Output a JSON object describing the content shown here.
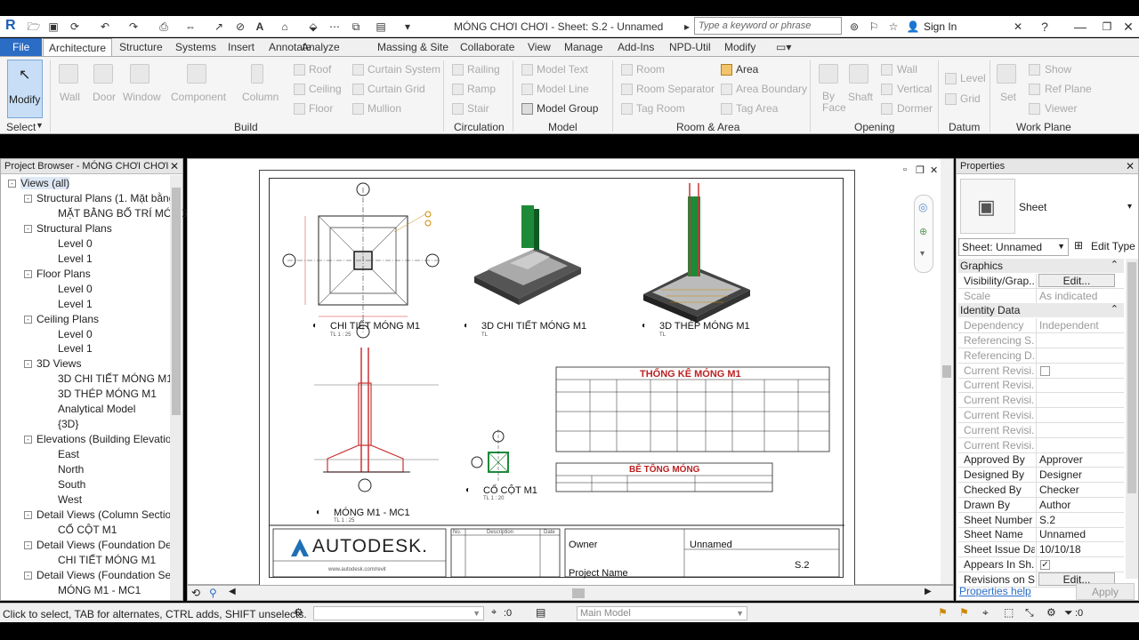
{
  "titlebar": {
    "app_letter": "R",
    "title": "MÓNG CHƠI CHƠI - Sheet: S.2 - Unnamed",
    "search_placeholder": "Type a keyword or phrase",
    "sign_in": "Sign In"
  },
  "ribbon_tabs": [
    "File",
    "Architecture",
    "Structure",
    "Systems",
    "Insert",
    "Annotate",
    "Analyze",
    "Massing & Site",
    "Collaborate",
    "View",
    "Manage",
    "Add-Ins",
    "NPD-Util",
    "Modify"
  ],
  "ribbon": {
    "modify": "Modify",
    "select": "Select",
    "build": {
      "wall": "Wall",
      "door": "Door",
      "window": "Window",
      "component": "Component",
      "column": "Column",
      "roof": "Roof",
      "ceiling": "Ceiling",
      "floor": "Floor",
      "curtain_system": "Curtain System",
      "curtain_grid": "Curtain Grid",
      "mullion": "Mullion",
      "label": "Build"
    },
    "circulation": {
      "railing": "Railing",
      "ramp": "Ramp",
      "stair": "Stair",
      "label": "Circulation"
    },
    "model": {
      "model_text": "Model Text",
      "model_line": "Model Line",
      "model_group": "Model Group",
      "label": "Model"
    },
    "room_area": {
      "room": "Room",
      "room_separator": "Room Separator",
      "tag_room": "Tag Room",
      "area": "Area",
      "area_boundary": "Area Boundary",
      "tag_area": "Tag Area",
      "label": "Room & Area"
    },
    "opening": {
      "by_face": "By Face",
      "shaft": "Shaft",
      "wall": "Wall",
      "vertical": "Vertical",
      "dormer": "Dormer",
      "label": "Opening"
    },
    "datum": {
      "level": "Level",
      "grid": "Grid",
      "label": "Datum"
    },
    "work_plane": {
      "set": "Set",
      "show": "Show",
      "ref_plane": "Ref Plane",
      "viewer": "Viewer",
      "label": "Work Plane"
    }
  },
  "project_browser": {
    "title": "Project Browser - MÓNG CHƠI CHƠI",
    "items": [
      {
        "label": "Views (all)",
        "level": 0,
        "toggle": "-"
      },
      {
        "label": "Structural Plans (1. Mặt bằng",
        "level": 1,
        "toggle": "-"
      },
      {
        "label": "MẶT BẰNG BỐ TRÍ MÓNG",
        "level": 2
      },
      {
        "label": "Structural Plans",
        "level": 1,
        "toggle": "-"
      },
      {
        "label": "Level 0",
        "level": 2
      },
      {
        "label": "Level 1",
        "level": 2
      },
      {
        "label": "Floor Plans",
        "level": 1,
        "toggle": "-"
      },
      {
        "label": "Level 0",
        "level": 2
      },
      {
        "label": "Level 1",
        "level": 2
      },
      {
        "label": "Ceiling Plans",
        "level": 1,
        "toggle": "-"
      },
      {
        "label": "Level 0",
        "level": 2
      },
      {
        "label": "Level 1",
        "level": 2
      },
      {
        "label": "3D Views",
        "level": 1,
        "toggle": "-"
      },
      {
        "label": "3D CHI TIẾT MÓNG M1",
        "level": 2
      },
      {
        "label": "3D THÉP MÓNG M1",
        "level": 2
      },
      {
        "label": "Analytical Model",
        "level": 2
      },
      {
        "label": "{3D}",
        "level": 2
      },
      {
        "label": "Elevations (Building Elevation",
        "level": 1,
        "toggle": "-"
      },
      {
        "label": "East",
        "level": 2
      },
      {
        "label": "North",
        "level": 2
      },
      {
        "label": "South",
        "level": 2
      },
      {
        "label": "West",
        "level": 2
      },
      {
        "label": "Detail Views (Column Section",
        "level": 1,
        "toggle": "-"
      },
      {
        "label": "CỔ CỘT M1",
        "level": 2
      },
      {
        "label": "Detail Views (Foundation Deta",
        "level": 1,
        "toggle": "-"
      },
      {
        "label": "CHI TIẾT MÓNG M1",
        "level": 2
      },
      {
        "label": "Detail Views (Foundation Sect",
        "level": 1,
        "toggle": "-"
      },
      {
        "label": "MÓNG M1 - MC1",
        "level": 2
      }
    ]
  },
  "sheet": {
    "views": [
      {
        "num": "S2",
        "sub": "5",
        "title": "CHI TIẾT MÓNG M1",
        "scale": "TL 1 : 25"
      },
      {
        "num": "S2",
        "sub": "4",
        "title": "3D CHI TIẾT MÓNG M1",
        "scale": "TL"
      },
      {
        "num": "S2",
        "sub": "3",
        "title": "3D THÉP MÓNG M1",
        "scale": "TL"
      },
      {
        "num": "S2",
        "sub": "2",
        "title": "MÓNG M1 - MC1",
        "scale": "TL 1 : 25"
      },
      {
        "num": "S2",
        "sub": "1",
        "title": "CỔ CỘT M1",
        "scale": "TL 1 : 20"
      }
    ],
    "schedule1_title": "THỐNG KÊ MÓNG M1",
    "schedule2_title": "BÊ TÔNG MÓNG",
    "titleblock": {
      "logo": "AUTODESK.",
      "url": "www.autodesk.com/revit",
      "rev_no": "No.",
      "rev_desc": "Description",
      "rev_date": "Date",
      "owner": "Owner",
      "project_name": "Project Name",
      "sheet_name": "Unnamed",
      "sheet_number": "S.2"
    }
  },
  "properties": {
    "title": "Properties",
    "type": "Sheet",
    "selector": "Sheet: Unnamed",
    "edit_type": "Edit Type",
    "sections": [
      {
        "name": "Graphics",
        "rows": [
          {
            "k": "Visibility/Grap...",
            "v": "Edit...",
            "btn": true
          },
          {
            "k": "Scale",
            "v": "As indicated",
            "dim": true
          }
        ]
      },
      {
        "name": "Identity Data",
        "rows": [
          {
            "k": "Dependency",
            "v": "Independent",
            "dim": true
          },
          {
            "k": "Referencing S...",
            "v": "",
            "dim": true
          },
          {
            "k": "Referencing D...",
            "v": "",
            "dim": true
          },
          {
            "k": "Current Revisi...",
            "v": "",
            "dim": true,
            "check": true
          },
          {
            "k": "Current Revisi...",
            "v": "",
            "dim": true
          },
          {
            "k": "Current Revisi...",
            "v": "",
            "dim": true
          },
          {
            "k": "Current Revisi...",
            "v": "",
            "dim": true
          },
          {
            "k": "Current Revisi...",
            "v": "",
            "dim": true
          },
          {
            "k": "Current Revisi...",
            "v": "",
            "dim": true
          },
          {
            "k": "Approved By",
            "v": "Approver"
          },
          {
            "k": "Designed By",
            "v": "Designer"
          },
          {
            "k": "Checked By",
            "v": "Checker"
          },
          {
            "k": "Drawn By",
            "v": "Author"
          },
          {
            "k": "Sheet Number",
            "v": "S.2"
          },
          {
            "k": "Sheet Name",
            "v": "Unnamed"
          },
          {
            "k": "Sheet Issue Date",
            "v": "10/10/18"
          },
          {
            "k": "Appears In Sh...",
            "v": "",
            "check": true,
            "checked": true
          },
          {
            "k": "Revisions on S...",
            "v": "Edit...",
            "btn": true
          }
        ]
      }
    ],
    "help": "Properties help",
    "apply": "Apply"
  },
  "statusbar": {
    "message": "Click to select, TAB for alternates, CTRL adds, SHIFT unselects.",
    "count": ":0",
    "workset": "Main Model",
    "filter": ":0"
  }
}
